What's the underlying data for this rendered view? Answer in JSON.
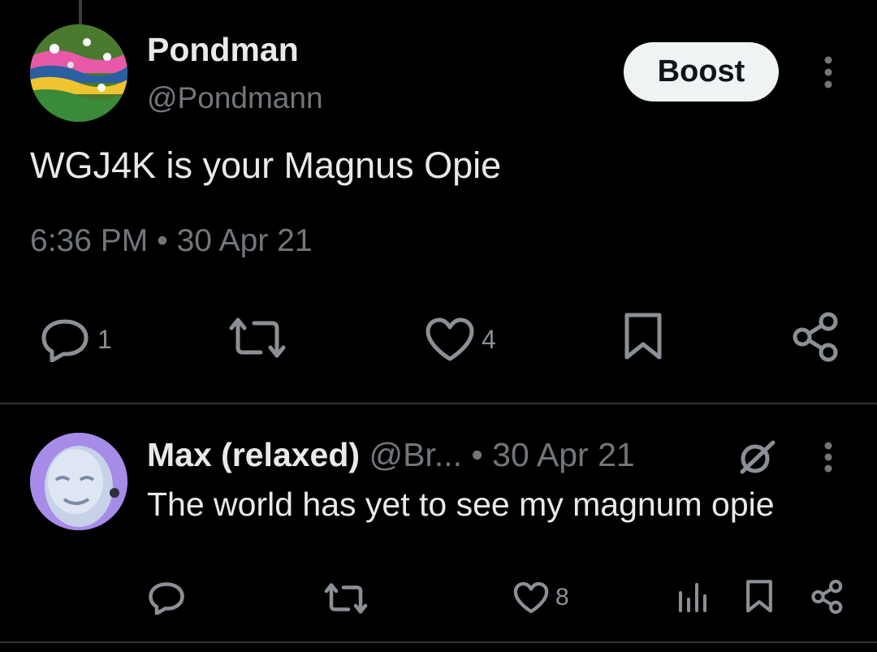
{
  "main_post": {
    "author_name": "Pondman",
    "author_handle": "@Pondmann",
    "boost_label": "Boost",
    "text": "WGJ4K is your Magnus Opie",
    "timestamp": "6:36 PM • 30 Apr 21",
    "actions": {
      "reply_count": "1",
      "like_count": "4"
    }
  },
  "reply_post": {
    "author_name": "Max (relaxed)",
    "author_handle": "@Br...",
    "date": "• 30 Apr 21",
    "text": "The world has yet to see my magnum opie",
    "actions": {
      "like_count": "8"
    }
  },
  "icons": [
    "more-vertical-icon",
    "reply-icon",
    "retweet-icon",
    "like-icon",
    "bookmark-icon",
    "share-icon",
    "grok-icon",
    "views-icon"
  ],
  "colors": {
    "background": "#000000",
    "primary_text": "#e7e9ea",
    "secondary_text": "#71767b",
    "boost_bg": "#eff3f4",
    "divider": "#2f3336"
  }
}
